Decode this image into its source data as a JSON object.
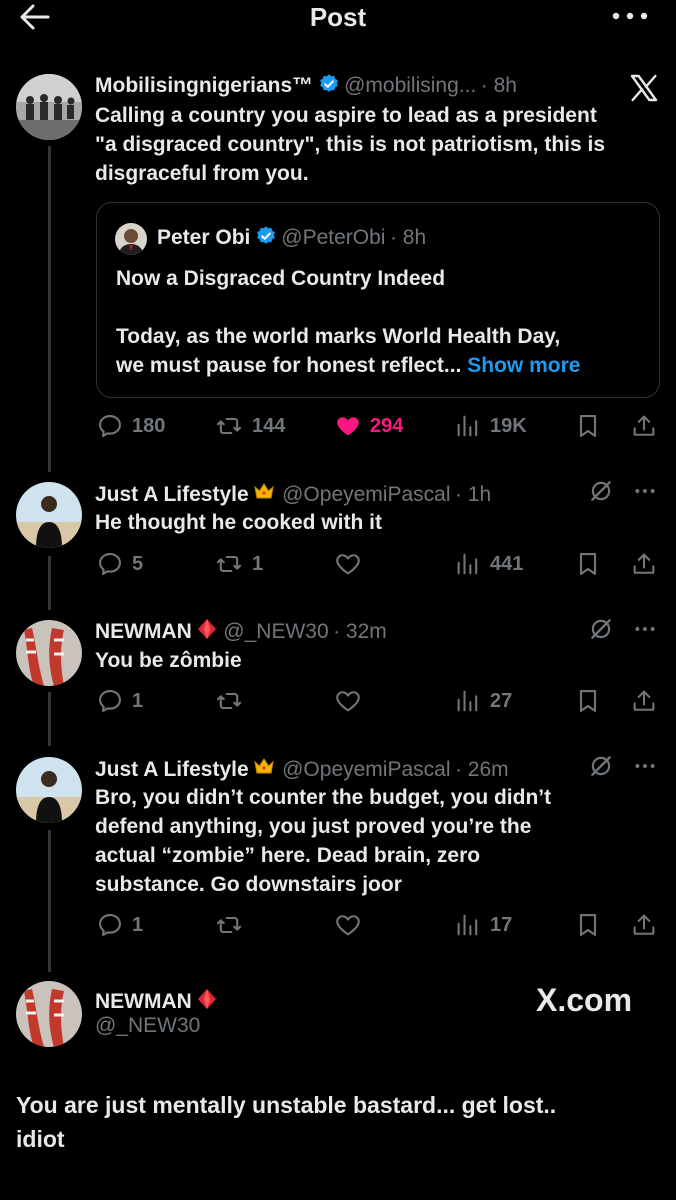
{
  "header": {
    "title": "Post",
    "back_icon": "arrow-left-icon",
    "more_icon": "more-horizontal-icon"
  },
  "main_post": {
    "name": "Mobilisingnigerians™",
    "handle": "@mobilising...",
    "time": "· 8h",
    "text_line1": "Calling a country you aspire to lead as a president",
    "text_line2": "\"a disgraced country\", this is not patriotism, this is",
    "text_line3": "disgraceful from you.",
    "quote": {
      "name": "Peter Obi",
      "handle": "@PeterObi",
      "time": "· 8h",
      "line1": "Now a Disgraced Country Indeed",
      "line2": "Today, as the world marks World Health Day,",
      "line3": "we must pause for honest reflect...",
      "show_more": "Show more"
    },
    "stats": {
      "replies": "180",
      "reposts": "144",
      "likes": "294",
      "views": "19K"
    }
  },
  "replies": [
    {
      "name": "Just A Lifestyle",
      "handle": "@OpeyemiPascal",
      "time": "· 1h",
      "text": "He thought he cooked with it",
      "replies": "5",
      "reposts": "1",
      "likes": "",
      "views": "441"
    },
    {
      "name": "NEWMAN",
      "handle": "@_NEW30",
      "time": "· 32m",
      "text": "You be zômbie",
      "replies": "1",
      "reposts": "",
      "likes": "",
      "views": "27"
    },
    {
      "name": "Just A Lifestyle",
      "handle": "@OpeyemiPascal",
      "time": "· 26m",
      "text_line1": "Bro, you didn’t counter the budget, you didn’t",
      "text_line2": "defend anything, you just proved you’re the",
      "text_line3": "actual “zombie” here. Dead brain, zero",
      "text_line4": "substance. Go downstairs joor",
      "replies": "1",
      "reposts": "",
      "likes": "",
      "views": "17"
    }
  ],
  "final_post": {
    "name": "NEWMAN",
    "handle": "@_NEW30",
    "watermark": "X.com",
    "text_line1": "You are just mentally unstable bastard... get lost..",
    "text_line2": "idiot"
  },
  "colors": {
    "background": "#000000",
    "text": "#e7e9ea",
    "muted": "#71767b",
    "accent_blue": "#1d9bf0",
    "like_pink": "#f91880",
    "border": "#2f3336"
  }
}
